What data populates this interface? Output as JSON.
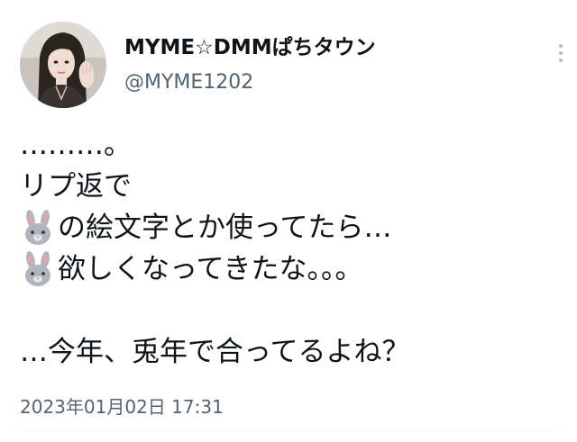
{
  "user": {
    "display_name": "MYME☆DMMぱちタウン",
    "handle": "@MYME1202",
    "avatar": "profile-photo"
  },
  "more_icon": "more-vertical-icon",
  "tweet": {
    "line1": "………。",
    "line2": "リプ返で",
    "line3_text": "の絵文字とか使ってたら…",
    "line4_text": "欲しくなってきたな。。。",
    "line5": "…今年、兎年で合ってるよね？",
    "emoji": "rabbit-face-icon"
  },
  "timestamp": "2023年01月02日 17:31",
  "colors": {
    "text": "#0f1419",
    "secondary": "#536471",
    "emoji_fur": "#aeb5bd",
    "emoji_ear": "#e0a6b6"
  }
}
